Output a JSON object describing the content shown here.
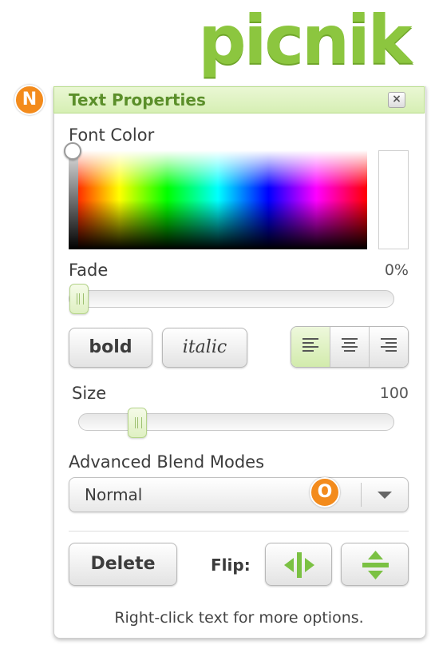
{
  "brand": {
    "logo_text": "picnik",
    "color": "#8cc63f"
  },
  "panel": {
    "title": "Text Properties",
    "close_label": "×",
    "badges": {
      "title_badge": "N",
      "dropdown_badge": "O"
    }
  },
  "font_color": {
    "label": "Font Color",
    "selected_color": "#ffffff"
  },
  "fade": {
    "label": "Fade",
    "value_text": "0%",
    "value": 0
  },
  "style_buttons": {
    "bold": "bold",
    "italic": "italic"
  },
  "alignment": {
    "options": [
      "left-align-icon",
      "center-align-icon",
      "right-align-icon"
    ],
    "selected": "left-align-icon"
  },
  "size": {
    "label": "Size",
    "value_text": "100",
    "value": 0.19
  },
  "blend": {
    "label": "Advanced Blend Modes",
    "selected": "Normal"
  },
  "actions": {
    "delete_label": "Delete",
    "flip_label": "Flip:",
    "flip_horizontal_icon": "flip-horizontal-icon",
    "flip_vertical_icon": "flip-vertical-icon"
  },
  "footer_text": "Right-click text for more options.",
  "colors": {
    "accent": "#8cc63f",
    "badge": "#f38b1c",
    "header_bg": "#d6efb4"
  }
}
